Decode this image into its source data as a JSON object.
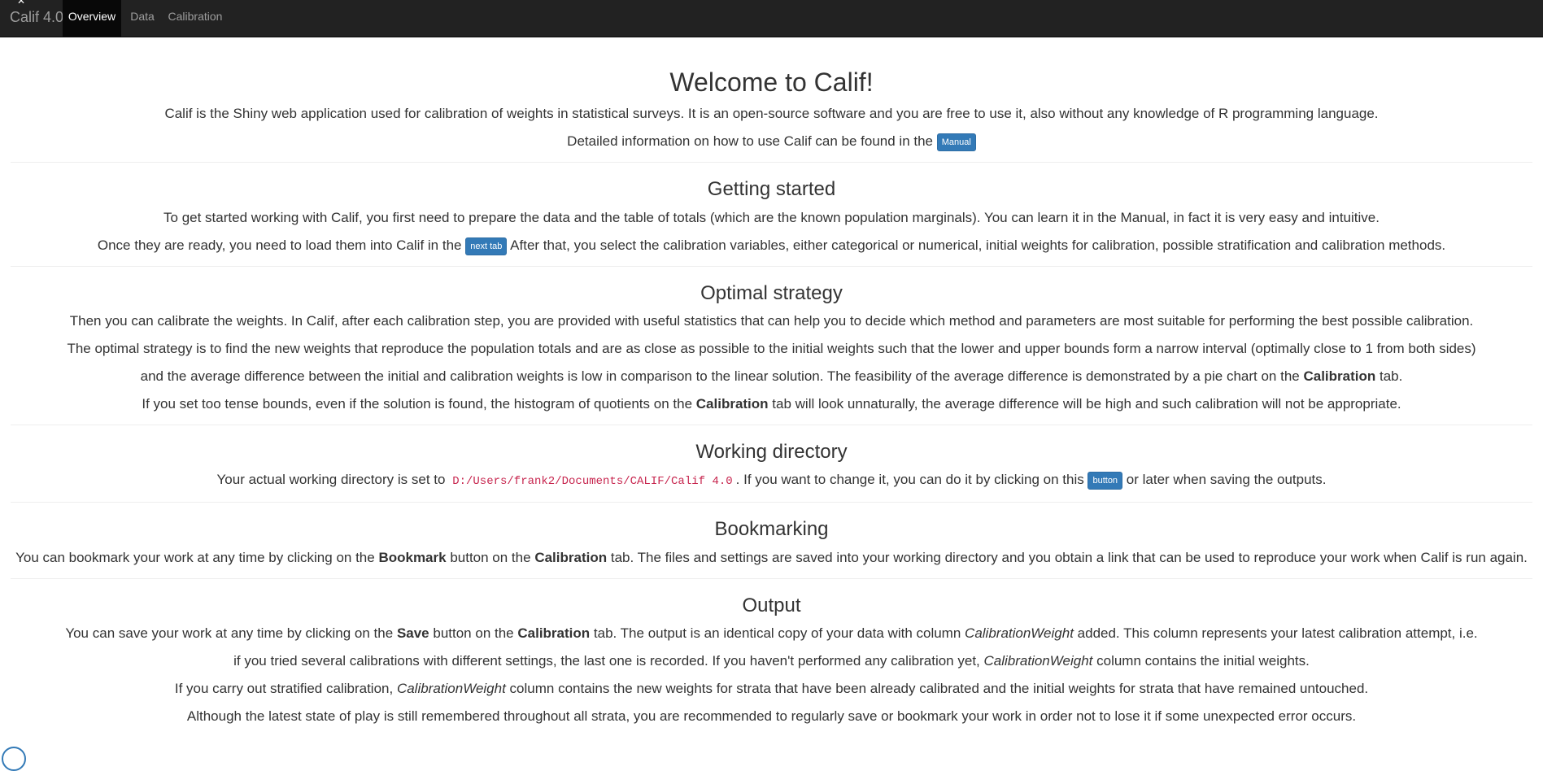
{
  "app": {
    "brand": "Calif 4.0",
    "tabs": [
      {
        "label": "Overview",
        "active": true
      },
      {
        "label": "Data",
        "active": false
      },
      {
        "label": "Calibration",
        "active": false
      }
    ]
  },
  "welcome": {
    "title": "Welcome to Calif!",
    "p1": "Calif is the Shiny web application used for calibration of weights in statistical surveys. It is an open-source software and you are free to use it, also without any knowledge of R programming language.",
    "p2_before": "Detailed information on how to use Calif can be found in the",
    "manual_button": "Manual"
  },
  "getting_started": {
    "title": "Getting started",
    "p1": "To get started working with Calif, you first need to prepare the data and the table of totals (which are the known population marginals). You can learn it in the Manual, in fact it is very easy and intuitive.",
    "p2_before": "Once they are ready, you need to load them into Calif in the",
    "next_tab_button": "next tab",
    "p2_after": "After that, you select the calibration variables, either categorical or numerical, initial weights for calibration, possible stratification and calibration methods."
  },
  "optimal_strategy": {
    "title": "Optimal strategy",
    "p1": "Then you can calibrate the weights. In Calif, after each calibration step, you are provided with useful statistics that can help you to decide which method and parameters are most suitable for performing the best possible calibration.",
    "p2": "The optimal strategy is to find the new weights that reproduce the population totals and are as close as possible to the initial weights such that the lower and upper bounds form a narrow interval (optimally close to 1 from both sides)",
    "p3_before": "and the average difference between the initial and calibration weights is low in comparison to the linear solution. The feasibility of the average difference is demonstrated by a pie chart on the",
    "p3_bold": "Calibration",
    "p3_after": "tab.",
    "p4_before": "If you set too tense bounds, even if the solution is found, the histogram of quotients on the",
    "p4_bold": "Calibration",
    "p4_after": "tab will look unnaturally, the average difference will be high and such calibration will not be appropriate."
  },
  "working_directory": {
    "title": "Working directory",
    "p_before": "Your actual working directory is set to",
    "path": "D:/Users/frank2/Documents/CALIF/Calif 4.0",
    "p_middle": ". If you want to change it, you can do it by clicking on this",
    "button": "button",
    "p_after": "or later when saving the outputs."
  },
  "bookmarking": {
    "title": "Bookmarking",
    "p_before": "You can bookmark your work at any time by clicking on the",
    "bold1": "Bookmark",
    "p_middle": "button on the",
    "bold2": "Calibration",
    "p_after": "tab. The files and settings are saved into your working directory and you obtain a link that can be used to reproduce your work when Calif is run again."
  },
  "output": {
    "title": "Output",
    "p1_a": "You can save your work at any time by clicking on the",
    "p1_bold1": "Save",
    "p1_b": "button on the",
    "p1_bold2": "Calibration",
    "p1_c": "tab. The output is an identical copy of your data with column",
    "p1_italic": "CalibrationWeight",
    "p1_d": "added. This column represents your latest calibration attempt, i.e.",
    "p2_a": "if you tried several calibrations with different settings, the last one is recorded. If you haven't performed any calibration yet,",
    "p2_italic": "CalibrationWeight",
    "p2_b": "column contains the initial weights.",
    "p3_a": "If you carry out stratified calibration,",
    "p3_italic": "CalibrationWeight",
    "p3_b": "column contains the new weights for strata that have been already calibrated and the initial weights for strata that have remained untouched.",
    "p4": "Although the latest state of play is still remembered throughout all strata, you are recommended to regularly save or bookmark your work in order not to lose it if some unexpected error occurs."
  }
}
